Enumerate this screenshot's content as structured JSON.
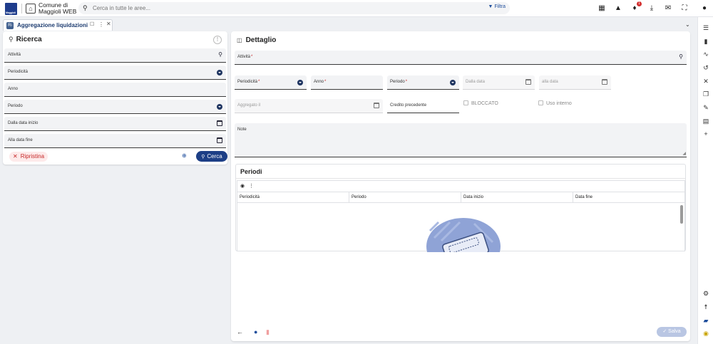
{
  "header": {
    "logo_text": "Maggioli",
    "org_name_line1": "Comune di",
    "org_name_line2": "Maggioli WEB",
    "search_placeholder": "Cerca in tutte le aree...",
    "filter_label": "Filtra",
    "notification_count": "1",
    "icons": [
      "bank-icon",
      "search-icon",
      "apps-icon",
      "warning-icon",
      "bell-icon",
      "download-icon",
      "mail-icon",
      "fullscreen-icon",
      "user-icon"
    ]
  },
  "tab": {
    "icon_text": "Ri",
    "label": "Aggregazione liquidazioni",
    "pin": "☐",
    "more": "⋮",
    "close": "✕"
  },
  "collapse_chevron": "⌄",
  "search_panel": {
    "title": "Ricerca",
    "fields": [
      {
        "label": "Attività",
        "kind": "search"
      },
      {
        "label": "Periodicità",
        "kind": "dropdown"
      },
      {
        "label": "Anno",
        "kind": "text"
      },
      {
        "label": "Periodo",
        "kind": "dropdown"
      },
      {
        "label": "Dalla data inizio",
        "kind": "date"
      },
      {
        "label": "Alla data fine",
        "kind": "date"
      }
    ],
    "reset_label": "Ripristina",
    "search_label": "Cerca"
  },
  "detail_panel": {
    "title": "Dettaglio",
    "attivita_label": "Attività",
    "periodicita_label": "Periodicità",
    "anno_label": "Anno",
    "periodo_label": "Periodo",
    "dalla_data_label": "Dalla data",
    "alla_data_label": "alla data",
    "aggregato_label": "Aggregato il",
    "credito_label": "Credito precedente",
    "bloccato_label": "BLOCCATO",
    "uso_interno_label": "Uso interno",
    "note_label": "Note",
    "required_mark": "*",
    "periodi": {
      "title": "Periodi",
      "columns": [
        "Periodicità",
        "Periodo",
        "Data inizio",
        "Data fine"
      ],
      "rows": []
    },
    "save_label": "Salva"
  },
  "colors": {
    "primary": "#1d3f86",
    "danger": "#c62828",
    "notification": "#d32f2f",
    "save_disabled": "#b9c6e3"
  }
}
